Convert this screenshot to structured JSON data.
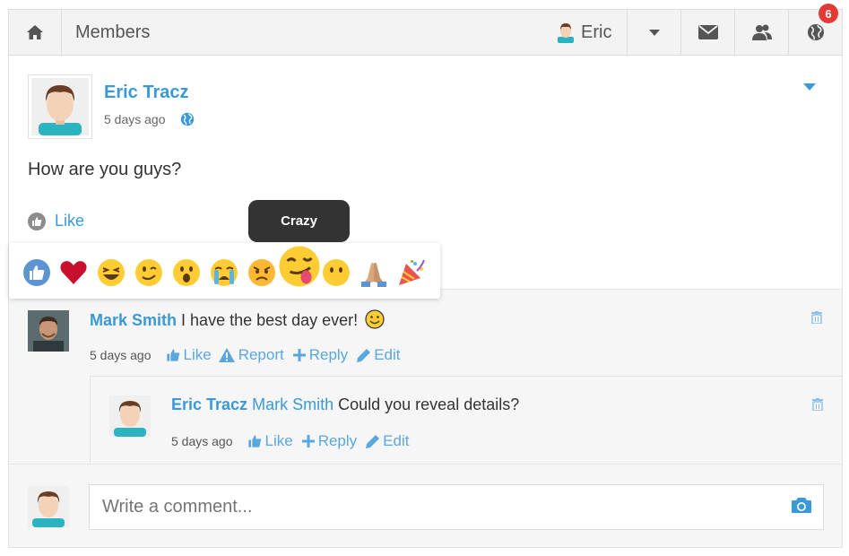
{
  "navbar": {
    "title": "Members",
    "user_name": "Eric",
    "notification_count": "6",
    "icons": [
      "home-icon",
      "caret-down-icon",
      "envelope-icon",
      "friends-icon",
      "globe-icon"
    ]
  },
  "post": {
    "author": "Eric Tracz",
    "time": "5 days ago",
    "text": "How are you guys?",
    "like_label": "Like"
  },
  "tooltip": "Crazy",
  "reactions": [
    "like",
    "love",
    "laugh",
    "wink",
    "wow",
    "cry",
    "angry",
    "crazy",
    "speechless",
    "pray",
    "party"
  ],
  "comments": [
    {
      "author": "Mark Smith",
      "text": "I have the best day ever!",
      "time": "5 days ago",
      "actions": {
        "like": "Like",
        "report": "Report",
        "reply": "Reply",
        "edit": "Edit"
      }
    },
    {
      "author": "Eric Tracz",
      "mention": "Mark Smith",
      "text": "Could you reveal details?",
      "time": "5 days ago",
      "actions": {
        "like": "Like",
        "reply": "Reply",
        "edit": "Edit"
      }
    }
  ],
  "composer": {
    "placeholder": "Write a comment..."
  },
  "colors": {
    "link": "#3a9ad9",
    "badge": "#e53935",
    "tooltip_bg": "#333333"
  }
}
